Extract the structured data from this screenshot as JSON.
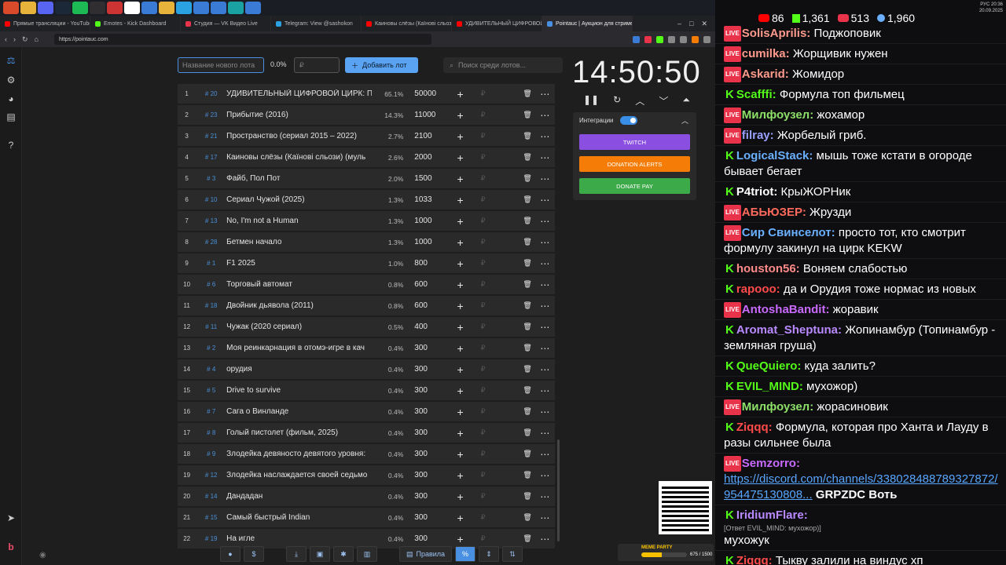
{
  "taskbar": {
    "icons": [
      "brave-icon",
      "folder-icon",
      "discord-icon",
      "steam-icon",
      "spotify-icon",
      "obs-icon",
      "media-icon",
      "x-icon",
      "app-icon",
      "folder-icon",
      "telegram-icon",
      "app-icon",
      "app-icon",
      "screen-icon",
      "app-icon"
    ]
  },
  "tabs": [
    {
      "title": "Прямые трансляции - YouTube Studio",
      "color": "#ff0000"
    },
    {
      "title": "Emotes - Kick Dashboard",
      "color": "#53fc18"
    },
    {
      "title": "Студия — VK Видео Live",
      "color": "#e8334a"
    },
    {
      "title": "Telegram: View @sashokon",
      "color": "#2aa1e0"
    },
    {
      "title": "Каиновы слёзы (Каїнові сльози)",
      "color": "#ff0000"
    },
    {
      "title": "УДИВИТЕЛЬНЫЙ ЦИФРОВОЙ ЦИРК",
      "color": "#ff0000"
    },
    {
      "title": "Pointauc | Аукцион для стримеров",
      "color": "#4a90e2",
      "active": true
    }
  ],
  "browser": {
    "url": "https://pointauc.com"
  },
  "sidebar": {
    "icons": [
      "gavel-icon",
      "gear-icon",
      "pie-chart-icon",
      "clipboard-icon",
      "help-icon",
      "telegram-icon",
      "brand-icon",
      "eye-icon"
    ]
  },
  "controls": {
    "new_lot_placeholder": "Название нового лота",
    "percent": "0.0%",
    "amount_placeholder": "₽",
    "add_button": "Добавить лот",
    "search_placeholder": "Поиск среди лотов..."
  },
  "lots": [
    {
      "n": "1",
      "id": "# 20",
      "name": "УДИВИТЕЛЬНЫЙ ЦИФРОВОЙ ЦИРК: П",
      "pct": "65.1%",
      "amount": "50000"
    },
    {
      "n": "2",
      "id": "# 23",
      "name": "Прибытие (2016)",
      "pct": "14.3%",
      "amount": "11000"
    },
    {
      "n": "3",
      "id": "# 21",
      "name": "Пространство (сериал 2015 – 2022)",
      "pct": "2.7%",
      "amount": "2100"
    },
    {
      "n": "4",
      "id": "# 17",
      "name": "Каиновы слёзы (Каїнові сльози) (муль",
      "pct": "2.6%",
      "amount": "2000"
    },
    {
      "n": "5",
      "id": "# 3",
      "name": "Файб, Пол Пот",
      "pct": "2.0%",
      "amount": "1500"
    },
    {
      "n": "6",
      "id": "# 10",
      "name": "Сериал Чужой (2025)",
      "pct": "1.3%",
      "amount": "1033"
    },
    {
      "n": "7",
      "id": "# 13",
      "name": "No, I'm not a Human",
      "pct": "1.3%",
      "amount": "1000"
    },
    {
      "n": "8",
      "id": "# 28",
      "name": "Бетмен начало",
      "pct": "1.3%",
      "amount": "1000"
    },
    {
      "n": "9",
      "id": "# 1",
      "name": "F1 2025",
      "pct": "1.0%",
      "amount": "800"
    },
    {
      "n": "10",
      "id": "# 6",
      "name": "Торговый автомат",
      "pct": "0.8%",
      "amount": "600"
    },
    {
      "n": "11",
      "id": "# 18",
      "name": "Двойник дьявола (2011)",
      "pct": "0.8%",
      "amount": "600"
    },
    {
      "n": "12",
      "id": "# 11",
      "name": "Чужак (2020 сериал)",
      "pct": "0.5%",
      "amount": "400"
    },
    {
      "n": "13",
      "id": "# 2",
      "name": "Моя реинкарнация в отомэ-игре в кач",
      "pct": "0.4%",
      "amount": "300"
    },
    {
      "n": "14",
      "id": "# 4",
      "name": "орудия",
      "pct": "0.4%",
      "amount": "300"
    },
    {
      "n": "15",
      "id": "# 5",
      "name": "Drive to survive",
      "pct": "0.4%",
      "amount": "300"
    },
    {
      "n": "16",
      "id": "# 7",
      "name": "Сага о Винланде",
      "pct": "0.4%",
      "amount": "300"
    },
    {
      "n": "17",
      "id": "# 8",
      "name": "Голый пистолет (фильм, 2025)",
      "pct": "0.4%",
      "amount": "300"
    },
    {
      "n": "18",
      "id": "# 9",
      "name": "Злодейка девяносто девятого уровня:",
      "pct": "0.4%",
      "amount": "300"
    },
    {
      "n": "19",
      "id": "# 12",
      "name": "Злодейка наслаждается своей седьмо",
      "pct": "0.4%",
      "amount": "300"
    },
    {
      "n": "20",
      "id": "# 14",
      "name": "Дандадан",
      "pct": "0.4%",
      "amount": "300"
    },
    {
      "n": "21",
      "id": "# 15",
      "name": "Самый быстрый Indian",
      "pct": "0.4%",
      "amount": "300"
    },
    {
      "n": "22",
      "id": "# 19",
      "name": "На игле",
      "pct": "0.4%",
      "amount": "300"
    }
  ],
  "timer": {
    "value": "14:50:50"
  },
  "integrations": {
    "label": "Интеграции",
    "enabled": true,
    "buttons": [
      {
        "label": "TWITCH",
        "color": "#8a4fe0"
      },
      {
        "label": "DONATION ALERTS",
        "color": "#f57d07"
      },
      {
        "label": "DONATE PAY",
        "color": "#3daa4a"
      }
    ]
  },
  "meme": {
    "title": "MEME PARTY",
    "progress_text": "675 / 1500",
    "progress": 0.45
  },
  "bottom_bar": {
    "rules_label": "Правила",
    "percent_label": "%"
  },
  "chat": {
    "systray": {
      "lang": "РУС",
      "time": "20:36",
      "date": "20.09.2025"
    },
    "stats": [
      {
        "platform": "youtube",
        "value": "86"
      },
      {
        "platform": "kick",
        "value": "1,361"
      },
      {
        "platform": "vk",
        "value": "513"
      },
      {
        "platform": "total",
        "value": "1,960"
      }
    ],
    "messages": [
      {
        "badge": "live",
        "nick": "SolisAprilis:",
        "color": "#ff9a8c",
        "text": "Поджоповик"
      },
      {
        "badge": "live",
        "nick": "cumilka:",
        "color": "#ff9a8c",
        "text": "Жорщивик нужен"
      },
      {
        "badge": "live",
        "nick": "Askarid:",
        "color": "#ff9a8c",
        "text": "Жомидор"
      },
      {
        "badge": "kick",
        "nick": "Scafffi:",
        "color": "#53fc18",
        "text": "Формула топ фильмец"
      },
      {
        "badge": "live",
        "nick": "Милфоузел:",
        "color": "#8de068",
        "text": "жохамор"
      },
      {
        "badge": "live",
        "nick": "filray:",
        "color": "#9aa0ff",
        "text": "Жорбелый гриб."
      },
      {
        "badge": "kick",
        "nick": "LogicalStack:",
        "color": "#6ab0ff",
        "text": "мышь тоже кстати в огороде бывает бегает"
      },
      {
        "badge": "kick",
        "nick": "P4triot:",
        "color": "#ffffff",
        "text": "КрыЖОРНик"
      },
      {
        "badge": "live",
        "nick": "АБЬЮЗЕР:",
        "color": "#ff6a5c",
        "text": "Жрузди"
      },
      {
        "badge": "live",
        "nick": "Сир Свинселот:",
        "color": "#6ab0ff",
        "text": "просто тот, кто смотрит формулу закинул на цирк KEKW"
      },
      {
        "badge": "kick",
        "nick": "houston56:",
        "color": "#ff8a8a",
        "text": "Воняем слабостью"
      },
      {
        "badge": "kick",
        "nick": "rapooo:",
        "color": "#ff4a4a",
        "text": "да и Орудия тоже нормас из новых"
      },
      {
        "badge": "live",
        "nick": "AntoshaBandit:",
        "color": "#c96aff",
        "text": "жоравик"
      },
      {
        "badge": "kick",
        "nick": "Aromat_Sheptuna:",
        "color": "#b98aff",
        "text": "Жопинамбур (Топинамбур - земляная груша)"
      },
      {
        "badge": "kick",
        "nick": "QueQuiero:",
        "color": "#53fc18",
        "text": "куда залить?"
      },
      {
        "badge": "kick",
        "nick": "EVIL_MIND:",
        "color": "#53fc18",
        "text": "мухожор)"
      },
      {
        "badge": "live",
        "nick": "Милфоузел:",
        "color": "#8de068",
        "text": "жорасиновик"
      },
      {
        "badge": "kick",
        "nick": "Ziqqq:",
        "color": "#ff4a4a",
        "text": "Формула, которая про Ханта и Лауду в разы сильнее была"
      },
      {
        "badge": "live",
        "nick": "Semzorro:",
        "color": "#c96aff",
        "text": "",
        "link": "https://discord.com/channels/338028488789327872/954475130808...",
        "extra": "GRPZDC Воть"
      },
      {
        "badge": "kick",
        "nick": "IridiumFlare:",
        "color": "#b98aff",
        "reply": "[Ответ EVIL_MIND: мухожор)]",
        "text": "мухожук"
      },
      {
        "badge": "kick",
        "nick": "Ziqqq:",
        "color": "#ff4a4a",
        "text": "Тыкву залили на виндус хп"
      }
    ]
  }
}
